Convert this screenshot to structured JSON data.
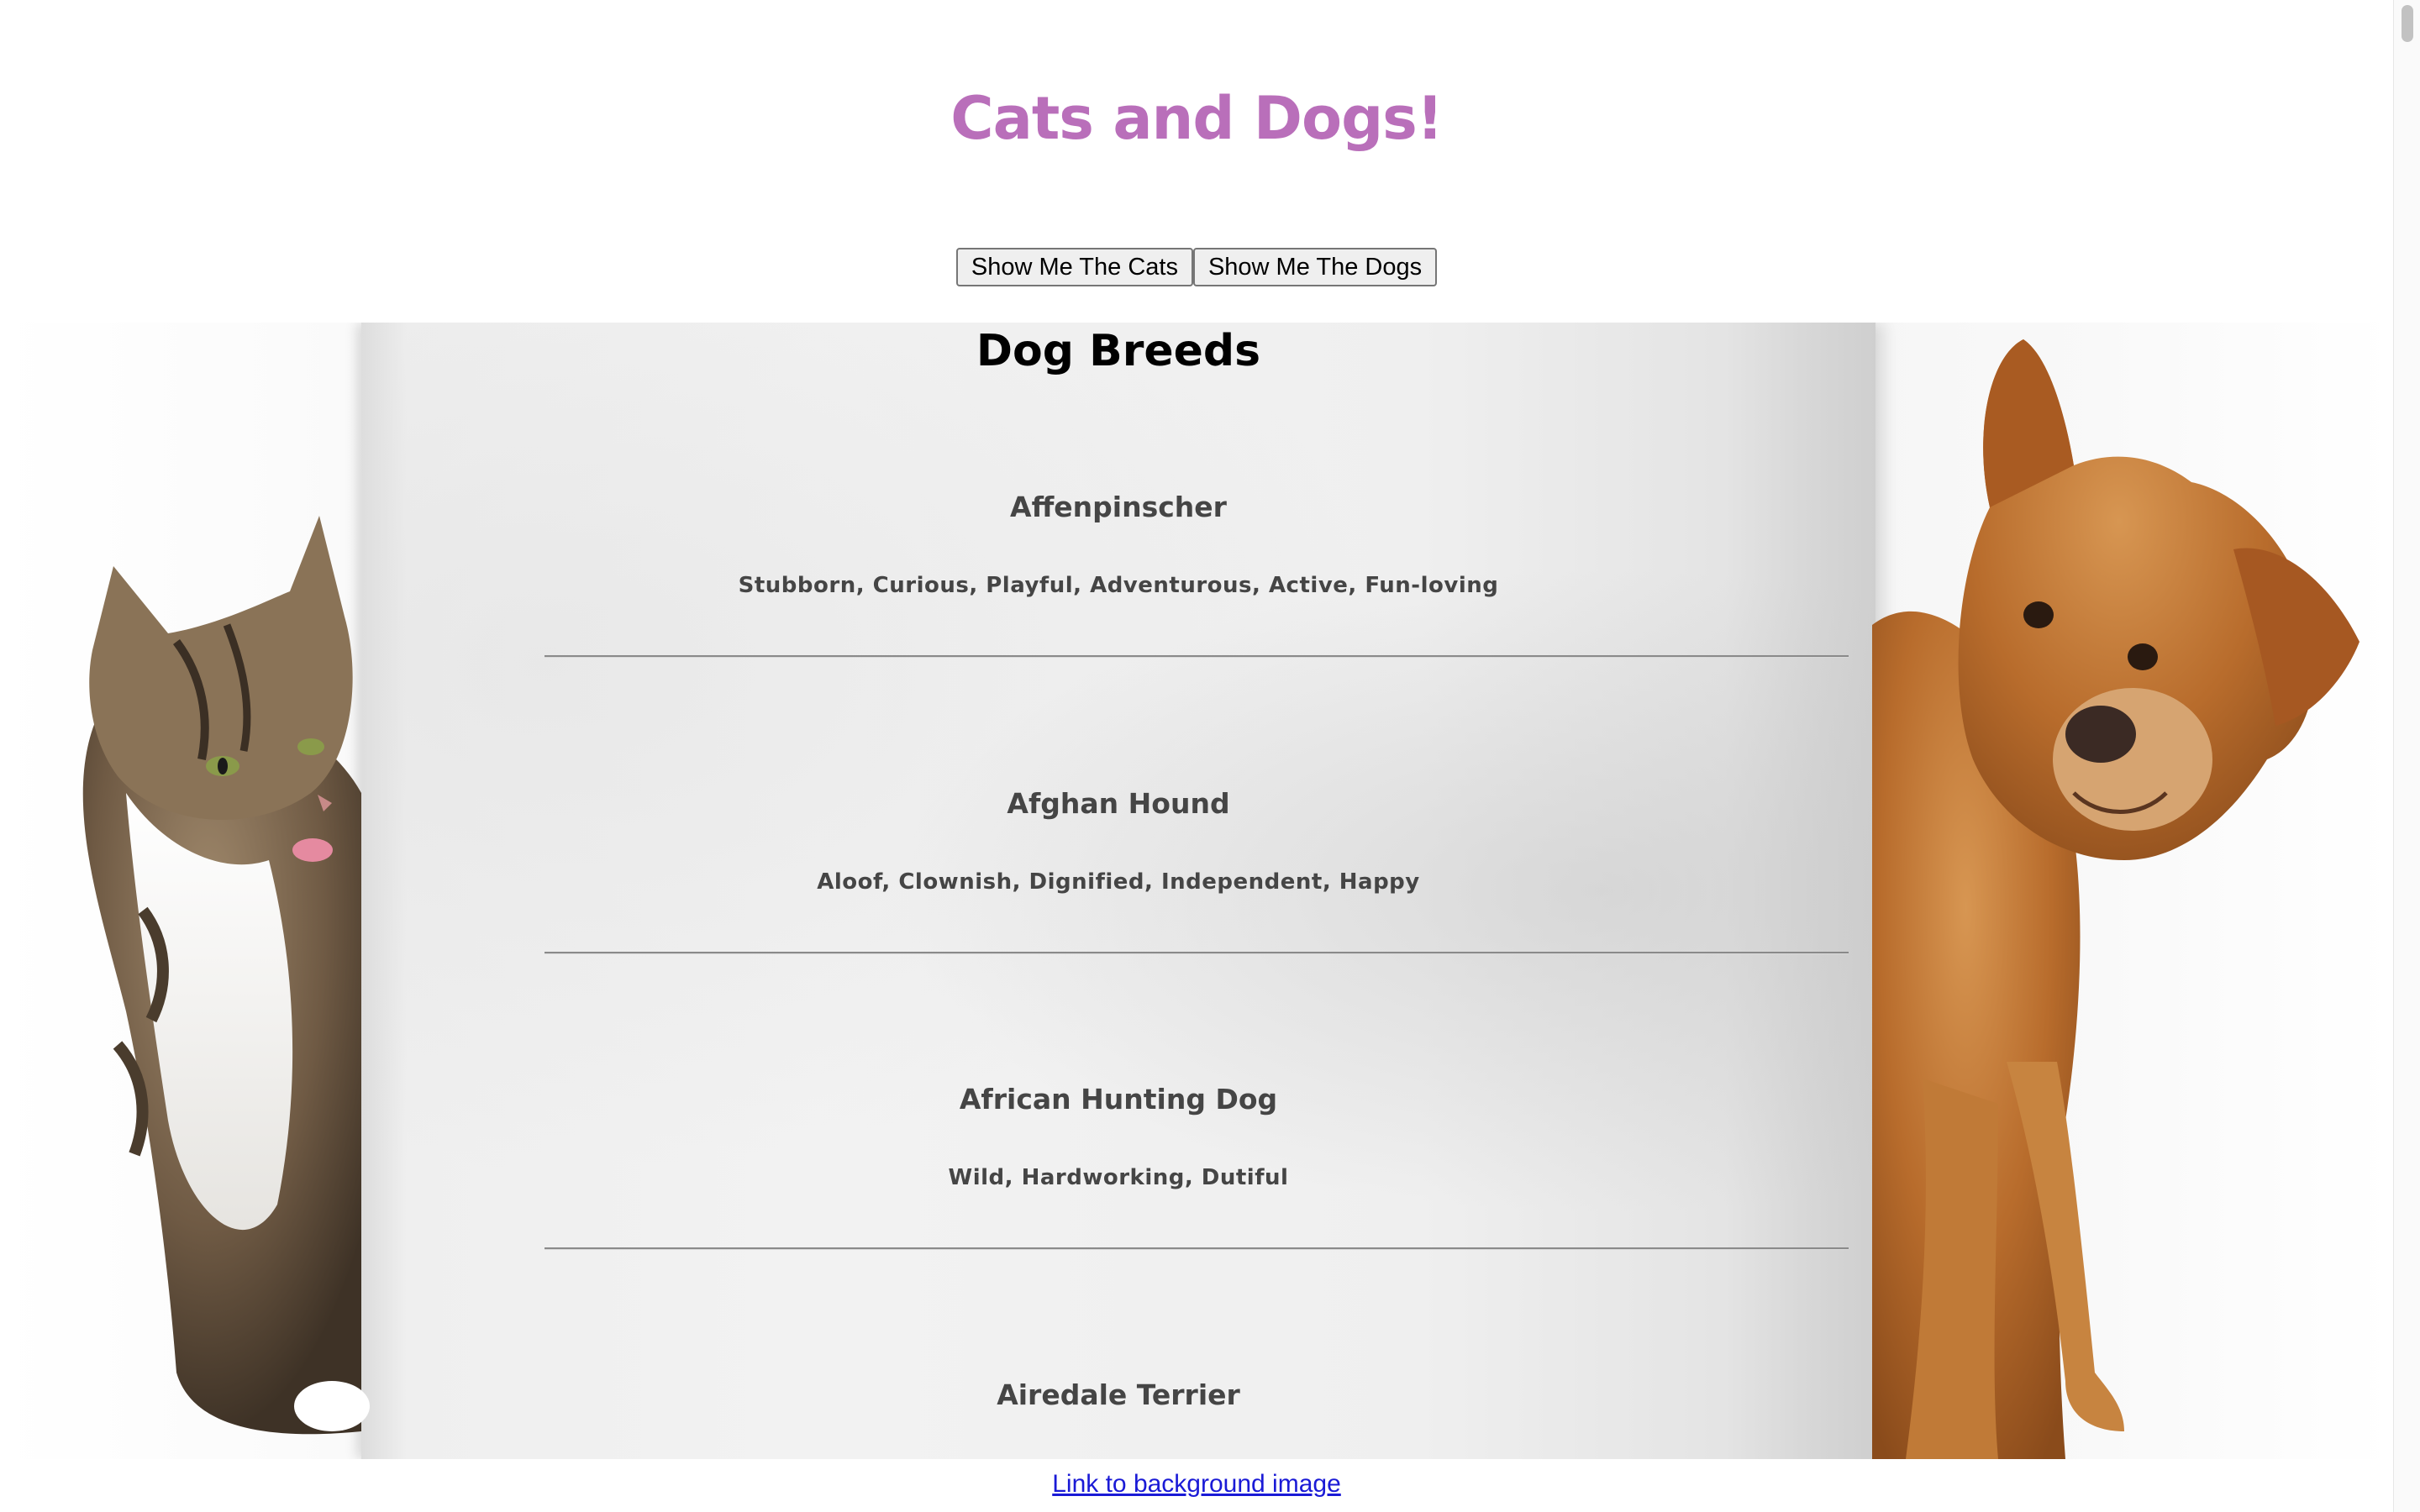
{
  "page": {
    "title": "Cats and Dogs!",
    "title_color": "#b96fba"
  },
  "buttons": {
    "cats_label": "Show Me The Cats",
    "dogs_label": "Show Me The Dogs"
  },
  "section": {
    "title": "Dog Breeds"
  },
  "breeds": [
    {
      "name": "Affenpinscher",
      "traits": "Stubborn, Curious, Playful, Adventurous, Active, Fun-loving"
    },
    {
      "name": "Afghan Hound",
      "traits": "Aloof, Clownish, Dignified, Independent, Happy"
    },
    {
      "name": "African Hunting Dog",
      "traits": "Wild, Hardworking, Dutiful"
    },
    {
      "name": "Airedale Terrier",
      "traits": ""
    }
  ],
  "footer": {
    "link_text": "Link to background image",
    "link_color": "#1a1ad6"
  },
  "icons": {
    "background": "cat-and-dog-photo"
  }
}
